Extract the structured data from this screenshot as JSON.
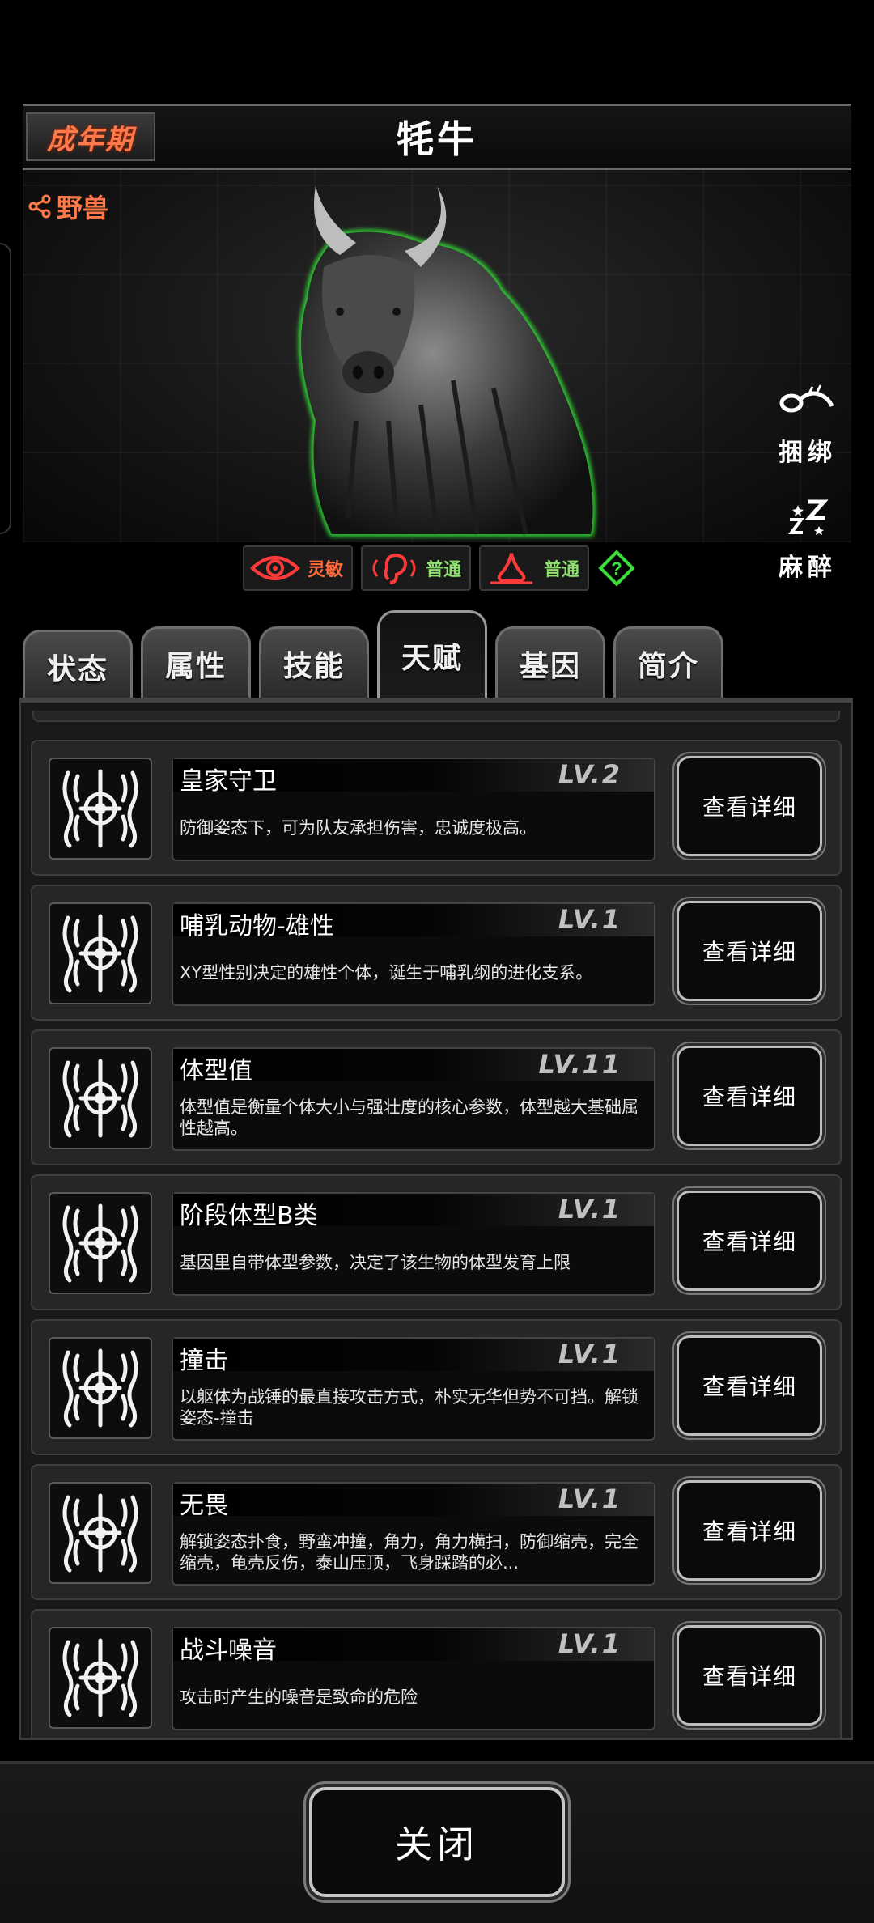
{
  "header": {
    "stage_label": "成年期",
    "title": "牦牛"
  },
  "species": {
    "label": "野兽",
    "icon": "share-icon"
  },
  "side_actions": [
    {
      "label": "捆绑",
      "icon": "rope-icon"
    },
    {
      "label": "麻醉",
      "icon": "sleep-zzz-icon"
    }
  ],
  "senses": [
    {
      "label": "灵敏",
      "icon": "eye-icon",
      "color": "#ff6a3a"
    },
    {
      "label": "普通",
      "icon": "ear-icon",
      "color": "#8fe070"
    },
    {
      "label": "普通",
      "icon": "nose-icon",
      "color": "#8fe070"
    }
  ],
  "help_icon": "question-icon",
  "tabs": [
    {
      "label": "状态",
      "active": false
    },
    {
      "label": "属性",
      "active": false
    },
    {
      "label": "技能",
      "active": false
    },
    {
      "label": "天赋",
      "active": true
    },
    {
      "label": "基因",
      "active": false
    },
    {
      "label": "简介",
      "active": false
    }
  ],
  "talents": [
    {
      "name": "皇家守卫",
      "level": "LV.2",
      "desc": "防御姿态下，可为队友承担伤害，忠诚度极高。",
      "button": "查看详细"
    },
    {
      "name": "哺乳动物-雄性",
      "level": "LV.1",
      "desc": "XY型性别决定的雄性个体，诞生于哺乳纲的进化支系。",
      "button": "查看详细"
    },
    {
      "name": "体型值",
      "level": "LV.11",
      "desc": "体型值是衡量个体大小与强壮度的核心参数，体型越大基础属性越高。",
      "button": "查看详细"
    },
    {
      "name": "阶段体型B类",
      "level": "LV.1",
      "desc": "基因里自带体型参数，决定了该生物的体型发育上限",
      "button": "查看详细"
    },
    {
      "name": "撞击",
      "level": "LV.1",
      "desc": "以躯体为战锤的最直接攻击方式，朴实无华但势不可挡。解锁姿态-撞击",
      "button": "查看详细"
    },
    {
      "name": "无畏",
      "level": "LV.1",
      "desc": "解锁姿态扑食，野蛮冲撞，角力，角力横扫，防御缩壳，完全缩壳，龟壳反伤，泰山压顶，飞身踩踏的必...",
      "button": "查看详细"
    },
    {
      "name": "战斗噪音",
      "level": "LV.1",
      "desc": "攻击时产生的噪音是致命的危险",
      "button": "查看详细"
    }
  ],
  "footer": {
    "close_label": "关闭"
  }
}
